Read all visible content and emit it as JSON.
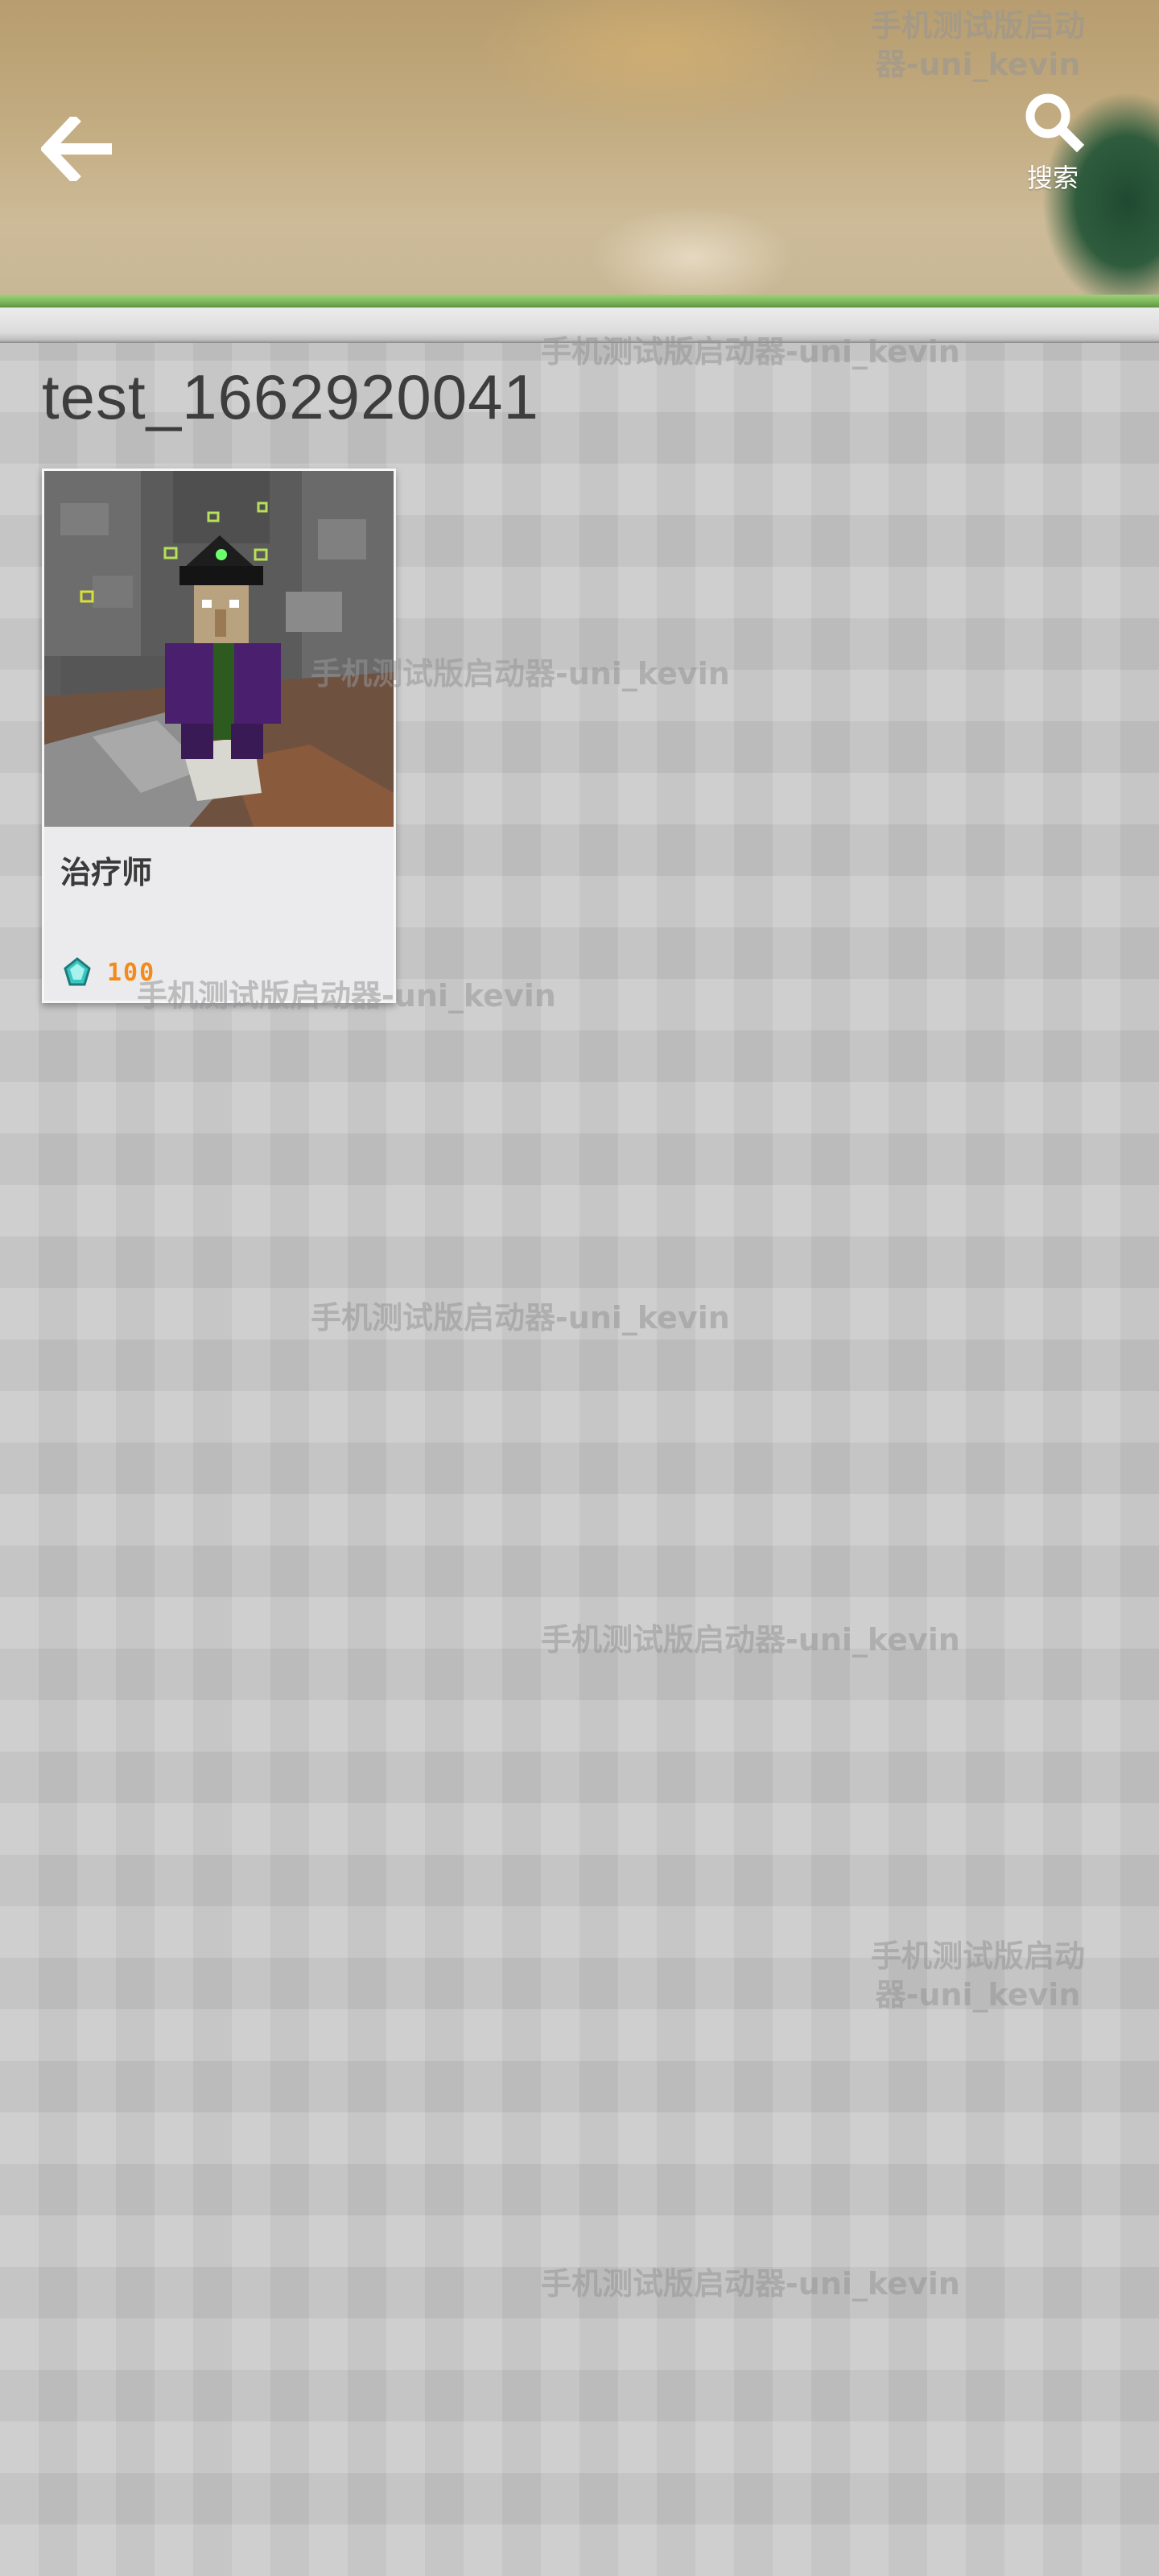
{
  "header": {
    "back_icon": "back-arrow-icon",
    "search_icon": "search-icon",
    "search_label": "搜索"
  },
  "page": {
    "title": "test_1662920041"
  },
  "cards": [
    {
      "name": "治疗师",
      "currency_icon": "diamond-icon",
      "price": "100",
      "price_color": "#f28a1c"
    }
  ],
  "watermark": {
    "text": "手机测试版启动器-uni_kevin",
    "line1": "手机测试版启动",
    "line2": "器-uni_kevin"
  },
  "colors": {
    "header_green": "#7ab457",
    "title_text": "#3d3d3d"
  }
}
